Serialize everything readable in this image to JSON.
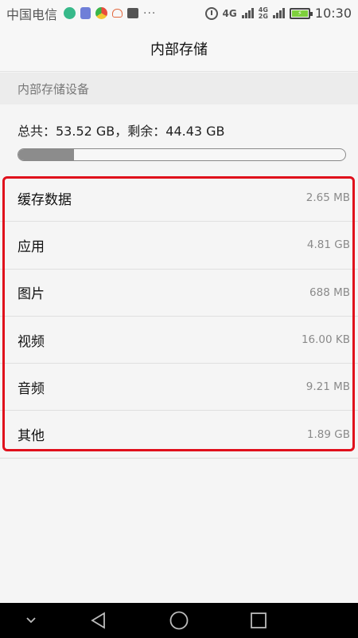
{
  "status_bar": {
    "carrier": "中国电信",
    "more": "···",
    "network": "4G",
    "network_secondary_top": "4G",
    "network_secondary_bottom": "2G",
    "time": "10:30"
  },
  "header": {
    "title": "内部存储"
  },
  "section": {
    "title": "内部存储设备"
  },
  "summary": {
    "text": "总共：53.52 GB，剩余：44.43 GB",
    "used_fraction": 0.17
  },
  "storage_items": [
    {
      "label": "缓存数据",
      "value": "2.65 MB"
    },
    {
      "label": "应用",
      "value": "4.81 GB"
    },
    {
      "label": "图片",
      "value": "688 MB"
    },
    {
      "label": "视频",
      "value": "16.00 KB"
    },
    {
      "label": "音频",
      "value": "9.21 MB"
    },
    {
      "label": "其他",
      "value": "1.89 GB"
    }
  ],
  "colors": {
    "highlight": "#e0101c",
    "progress_fill": "#8c8c8c"
  },
  "nav_icons": [
    "chevron-down-icon",
    "back-icon",
    "home-icon",
    "recent-apps-icon"
  ]
}
